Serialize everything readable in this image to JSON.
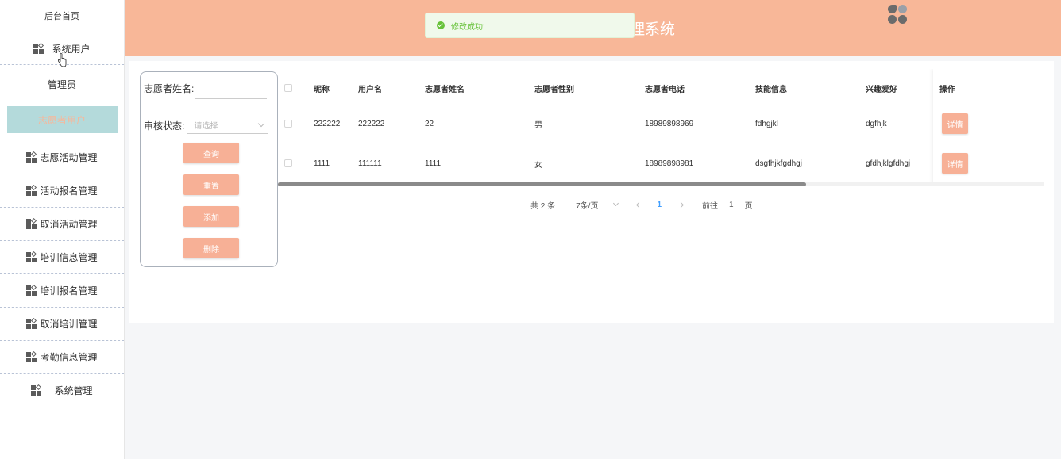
{
  "header": {
    "title": "理系统",
    "logo_icon": "app-logo-icon"
  },
  "toast": {
    "message": "修改成功!",
    "icon": "check-circle-icon"
  },
  "sidebar": {
    "home": "后台首页",
    "system_users": "系统用户",
    "sub_items": [
      "管理员",
      "志愿者用户"
    ],
    "items": [
      "志愿活动管理",
      "活动报名管理",
      "取消活动管理",
      "培训信息管理",
      "培训报名管理",
      "取消培训管理",
      "考勤信息管理",
      "系统管理"
    ]
  },
  "search": {
    "name_label": "志愿者姓名:",
    "name_value": "",
    "status_label": "审核状态:",
    "status_placeholder": "请选择",
    "buttons": {
      "query": "查询",
      "reset": "重置",
      "add": "添加",
      "delete": "删除"
    }
  },
  "table": {
    "headers": [
      "昵称",
      "用户名",
      "志愿者姓名",
      "志愿者性别",
      "志愿者电话",
      "技能信息",
      "兴趣爱好",
      "操作"
    ],
    "rows": [
      [
        "222222",
        "222222",
        "22",
        "男",
        "18989898969",
        "fdhgjkl",
        "dgfhjk"
      ],
      [
        "1111",
        "111111",
        "1111",
        "女",
        "18989898981",
        "dsgfhjkfgdhgj",
        "gfdhjklgfdhgj"
      ]
    ],
    "detail_label": "详情"
  },
  "pagination": {
    "total": "共 2 条",
    "page_size": "7条/页",
    "current_page": "1",
    "goto_label": "前往",
    "goto_value": "1",
    "page_unit": "页"
  },
  "colors": {
    "accent": "#f8b798",
    "button": "#f7b096",
    "active_bg": "#b4dadb"
  }
}
